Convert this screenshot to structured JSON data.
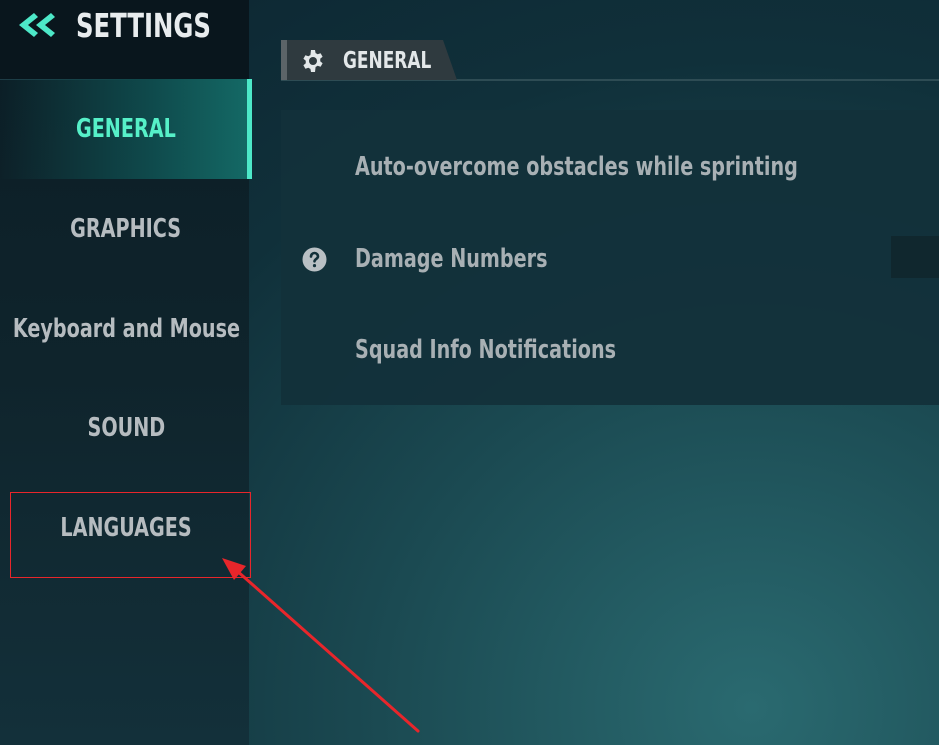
{
  "sidebar": {
    "title": "SETTINGS",
    "items": [
      {
        "label": "GENERAL",
        "active": true
      },
      {
        "label": "GRAPHICS",
        "active": false
      },
      {
        "label": "Keyboard and Mouse",
        "active": false
      },
      {
        "label": "SOUND",
        "active": false
      },
      {
        "label": "LANGUAGES",
        "active": false
      }
    ]
  },
  "tab": {
    "label": "GENERAL",
    "icon": "gear-icon"
  },
  "settings": [
    {
      "label": "Auto-overcome obstacles while sprinting",
      "has_help": false
    },
    {
      "label": "Damage Numbers",
      "has_help": true
    },
    {
      "label": "Squad Info Notifications",
      "has_help": false
    }
  ],
  "colors": {
    "accent": "#4de8c8",
    "active_text": "#56f0c8",
    "annotation": "#e8262b"
  }
}
